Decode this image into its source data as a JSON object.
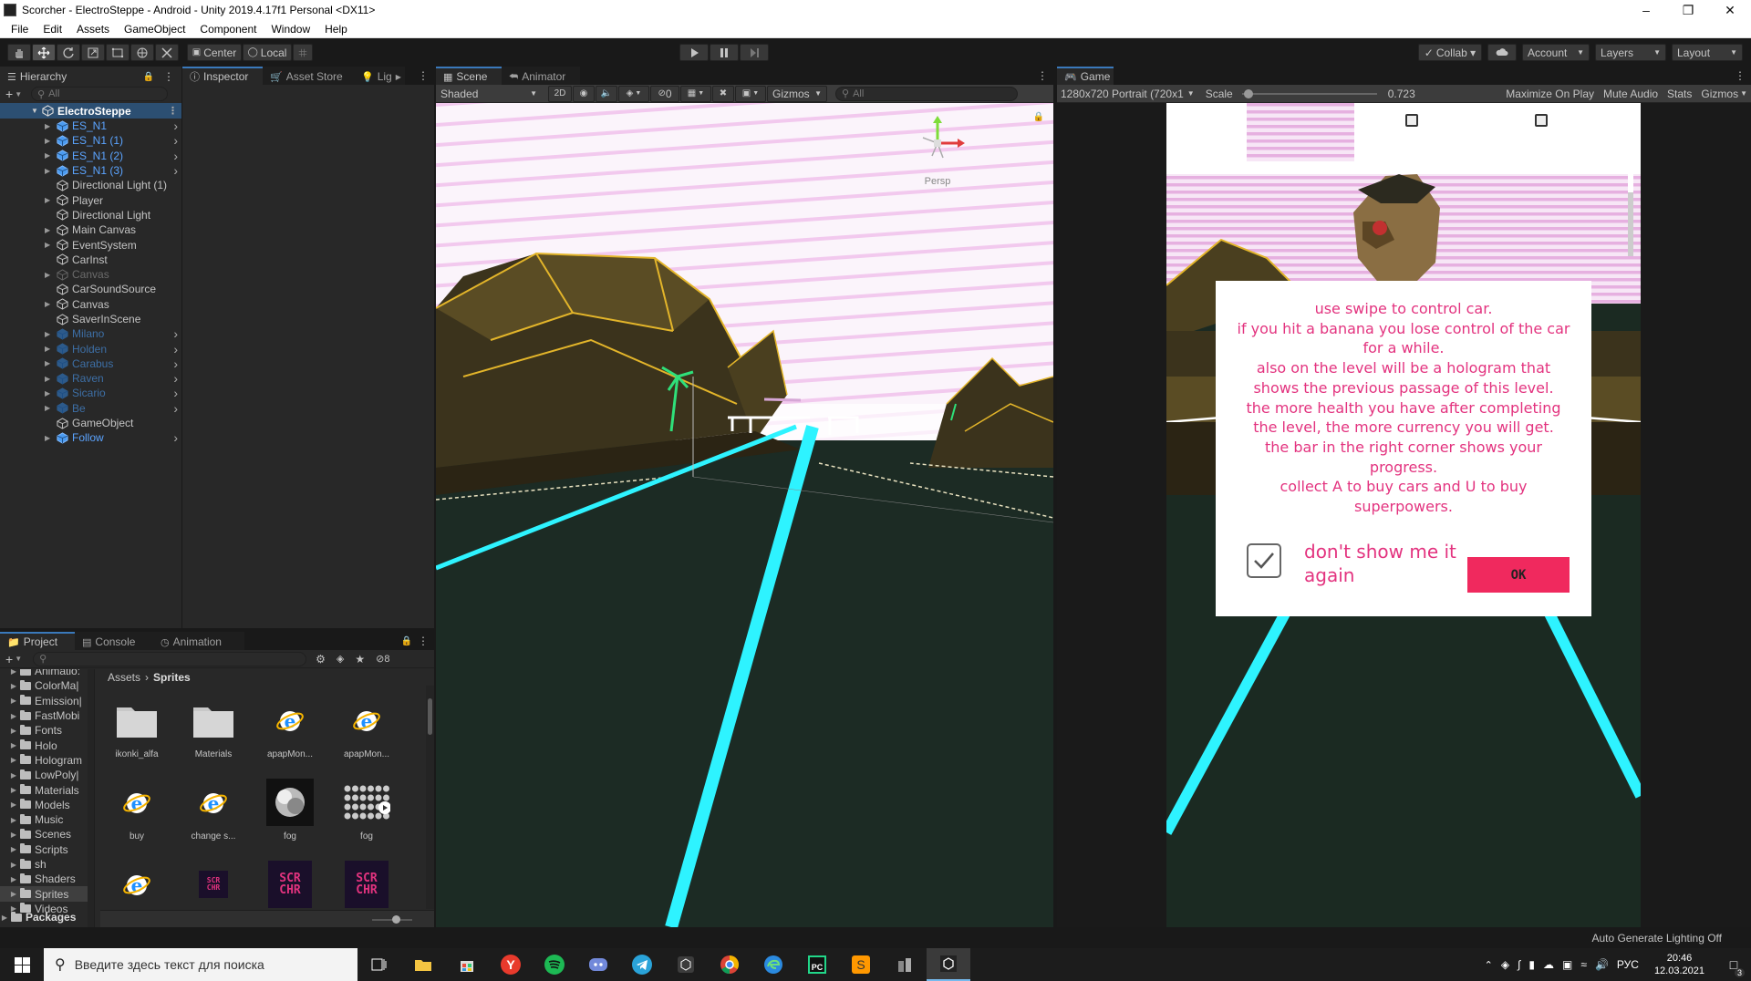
{
  "window": {
    "title": "Scorcher - ElectroSteppe - Android - Unity 2019.4.17f1 Personal <DX11>"
  },
  "menu": [
    "File",
    "Edit",
    "Assets",
    "GameObject",
    "Component",
    "Window",
    "Help"
  ],
  "toolbar": {
    "center_label": "Center",
    "local_label": "Local",
    "collab_label": "Collab ▾",
    "account_label": "Account",
    "layers_label": "Layers",
    "layout_label": "Layout"
  },
  "hierarchy": {
    "tab": "Hierarchy",
    "search_placeholder": "All",
    "scene_name": "ElectroSteppe",
    "items": [
      {
        "label": "ES_N1",
        "kind": "prefab",
        "chev": true
      },
      {
        "label": "ES_N1 (1)",
        "kind": "prefab",
        "chev": true
      },
      {
        "label": "ES_N1 (2)",
        "kind": "prefab",
        "chev": true
      },
      {
        "label": "ES_N1 (3)",
        "kind": "prefab",
        "chev": true
      },
      {
        "label": "Directional Light (1)",
        "kind": "go",
        "chev": false
      },
      {
        "label": "Player",
        "kind": "go",
        "chev": false
      },
      {
        "label": "Directional Light",
        "kind": "go",
        "chev": false
      },
      {
        "label": "Main Canvas",
        "kind": "go",
        "chev": false
      },
      {
        "label": "EventSystem",
        "kind": "go",
        "chev": false
      },
      {
        "label": "CarInst",
        "kind": "go",
        "chev": false
      },
      {
        "label": "Canvas",
        "kind": "disabled",
        "chev": false
      },
      {
        "label": "CarSoundSource",
        "kind": "go",
        "chev": false
      },
      {
        "label": "Canvas",
        "kind": "go",
        "chev": false
      },
      {
        "label": "SaverInScene",
        "kind": "go",
        "chev": false
      },
      {
        "label": "Milano",
        "kind": "prefab-disabled",
        "chev": true
      },
      {
        "label": "Holden",
        "kind": "prefab-disabled",
        "chev": true
      },
      {
        "label": "Carabus",
        "kind": "prefab-disabled",
        "chev": true
      },
      {
        "label": "Raven",
        "kind": "prefab-disabled",
        "chev": true
      },
      {
        "label": "Sicario",
        "kind": "prefab-disabled",
        "chev": true
      },
      {
        "label": "Be",
        "kind": "prefab-disabled",
        "chev": true
      },
      {
        "label": "GameObject",
        "kind": "go",
        "chev": false
      },
      {
        "label": "Follow",
        "kind": "prefab",
        "chev": true
      }
    ]
  },
  "inspector_tabs": {
    "inspector": "Inspector",
    "asset_store": "Asset Store",
    "lighting": "Lig"
  },
  "project": {
    "tabs": [
      "Project",
      "Console",
      "Animation"
    ],
    "hidden_count": "8",
    "folders": [
      "Animatio:",
      "ColorMa|",
      "Emission|",
      "FastMobi",
      "Fonts",
      "Holo",
      "Hologram",
      "LowPoly|",
      "Materials",
      "Models",
      "Music",
      "Scenes",
      "Scripts",
      "sh",
      "Shaders",
      "Sprites",
      "Videos"
    ],
    "packages": "Packages",
    "breadcrumb": [
      "Assets",
      "Sprites"
    ],
    "assets": [
      {
        "label": "ikonki_alfa",
        "kind": "folder"
      },
      {
        "label": "Materials",
        "kind": "folder"
      },
      {
        "label": "apapMon...",
        "kind": "ie"
      },
      {
        "label": "apapMon...",
        "kind": "ie"
      },
      {
        "label": "buy",
        "kind": "ie"
      },
      {
        "label": "change s...",
        "kind": "ie"
      },
      {
        "label": "fog",
        "kind": "fog"
      },
      {
        "label": "fog",
        "kind": "fogsheet"
      },
      {
        "label": "",
        "kind": "ie"
      },
      {
        "label": "",
        "kind": "logo-small"
      },
      {
        "label": "",
        "kind": "logo"
      },
      {
        "label": "",
        "kind": "logo"
      }
    ]
  },
  "scene_view": {
    "tabs": [
      "Scene",
      "Animator"
    ],
    "shading": "Shaded",
    "mode_2d": "2D",
    "hidden_count": "0",
    "gizmos": "Gizmos",
    "search_placeholder": "All",
    "persp": "Persp"
  },
  "game_view": {
    "tab": "Game",
    "resolution": "1280x720 Portrait (720x1",
    "scale_label": "Scale",
    "scale_value": "0.723",
    "scale_fraction": 0.05,
    "maximize": "Maximize On Play",
    "mute": "Mute Audio",
    "stats": "Stats",
    "gizmos": "Gizmos",
    "dialog": {
      "lines": [
        "use swipe to control car.",
        "if you hit a banana you lose control of the car",
        "for a while.",
        "also on the level will be a hologram that",
        "shows the previous passage of this level.",
        "the more health you have after completing",
        "the level, the more currency you will get.",
        "the bar in the right corner shows your",
        "progress.",
        "collect A to buy cars and U to buy",
        "superpowers."
      ],
      "checkbox_label": "don't show me it again",
      "ok_label": "ok"
    }
  },
  "status_bar": {
    "text": "Auto Generate Lighting Off"
  },
  "taskbar": {
    "search_placeholder": "Введите здесь текст для поиска",
    "lang": "РУС",
    "time": "20:46",
    "date": "12.03.2021",
    "notifications": "3"
  }
}
